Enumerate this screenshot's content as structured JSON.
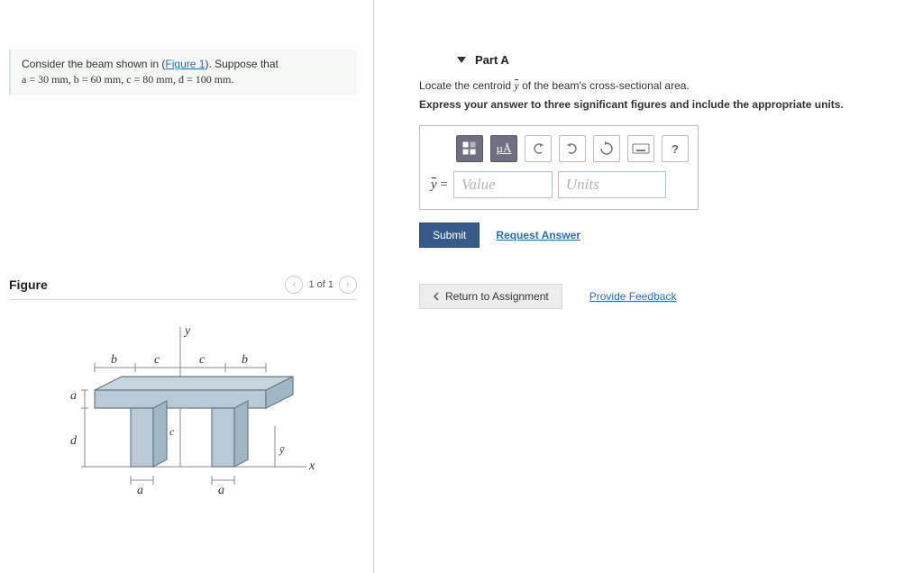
{
  "problem": {
    "prefix": "Consider the beam shown in (",
    "figure_link": "Figure 1",
    "suffix": "). Suppose that",
    "params_line": "a = 30 mm, b = 60 mm, c = 80 mm, d = 100 mm."
  },
  "figure_panel": {
    "title": "Figure",
    "pager": "1 of 1",
    "labels": {
      "a": "a",
      "b": "b",
      "c": "c",
      "d": "d",
      "x": "x",
      "y": "y",
      "ybar": "y"
    }
  },
  "partA": {
    "header": "Part A",
    "locate_prefix": "Locate the centroid ",
    "locate_symbol": "y",
    "locate_suffix": " of the beam's cross-sectional area.",
    "express": "Express your answer to three significant figures and include the appropriate units.",
    "toolbar": {
      "units_btn": "µÅ",
      "help": "?"
    },
    "eq_label": "ȳ =",
    "value_placeholder": "Value",
    "units_placeholder": "Units",
    "submit": "Submit",
    "request_answer": "Request Answer"
  },
  "bottom": {
    "return": "Return to Assignment",
    "feedback": "Provide Feedback"
  }
}
